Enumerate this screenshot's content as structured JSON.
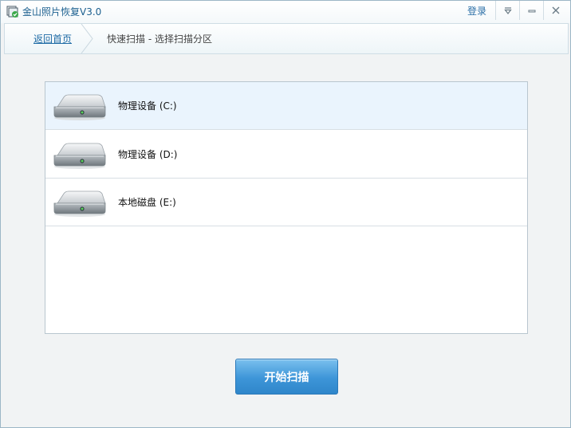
{
  "window": {
    "title": "金山照片恢复V3.0",
    "login_label": "登录"
  },
  "nav": {
    "back_label": "返回首页",
    "crumb": "快速扫描 - 选择扫描分区"
  },
  "drives": [
    {
      "label": "物理设备 (C:)",
      "icon": "hard-drive-icon",
      "selected": true
    },
    {
      "label": "物理设备 (D:)",
      "icon": "hard-drive-icon",
      "selected": false
    },
    {
      "label": "本地磁盘 (E:)",
      "icon": "hard-drive-icon",
      "selected": false
    }
  ],
  "actions": {
    "start_label": "开始扫描"
  },
  "colors": {
    "accent": "#3d95d8",
    "title_text": "#1b5f8f",
    "selected_row": "#eaf4fd"
  }
}
